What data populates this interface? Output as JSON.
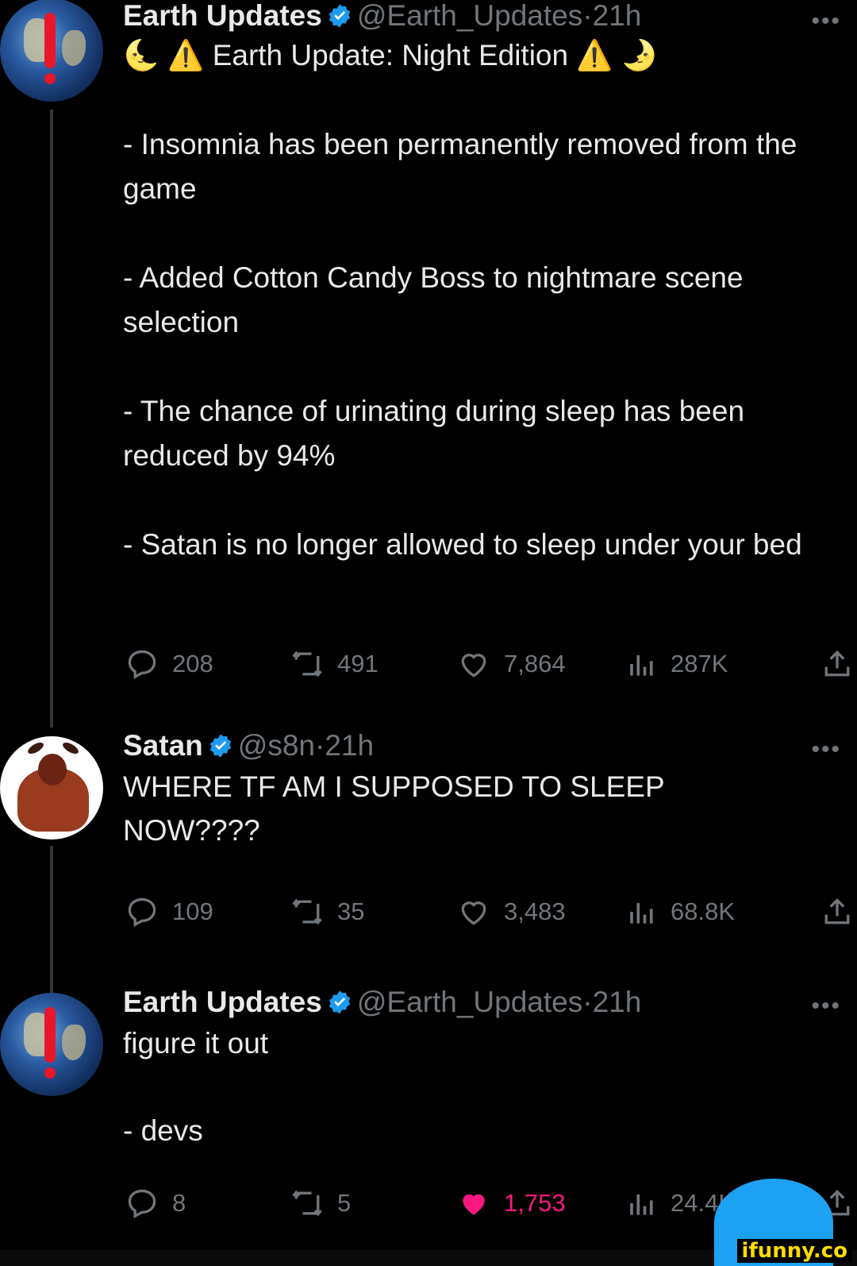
{
  "tweets": [
    {
      "name": "Earth Updates",
      "handle": "@Earth_Updates",
      "time": "21h",
      "text": "🌜 ⚠️ Earth Update: Night Edition ⚠️ 🌛\n\n- Insomnia has been permanently removed from the game\n\n- Added Cotton Candy Boss to nightmare scene selection\n\n- The chance of urinating during sleep has been reduced by 94%\n\n- Satan is no longer allowed to sleep under your bed",
      "replies": "208",
      "retweets": "491",
      "likes": "7,864",
      "views": "287K",
      "liked": false
    },
    {
      "name": "Satan",
      "handle": "@s8n",
      "time": "21h",
      "text": "WHERE TF AM I SUPPOSED TO SLEEP NOW????",
      "replies": "109",
      "retweets": "35",
      "likes": "3,483",
      "views": "68.8K",
      "liked": false
    },
    {
      "name": "Earth Updates",
      "handle": "@Earth_Updates",
      "time": "21h",
      "text": "figure it out\n\n- devs",
      "replies": "8",
      "retweets": "5",
      "likes": "1,753",
      "views": "24.4K",
      "liked": true
    }
  ],
  "separator": "·",
  "more_glyph": "•••",
  "watermark": "ifunny.co",
  "colors": {
    "background": "#000000",
    "text": "#e7e9ea",
    "muted": "#71767b",
    "verified": "#1d9bf0",
    "like": "#f91880"
  }
}
